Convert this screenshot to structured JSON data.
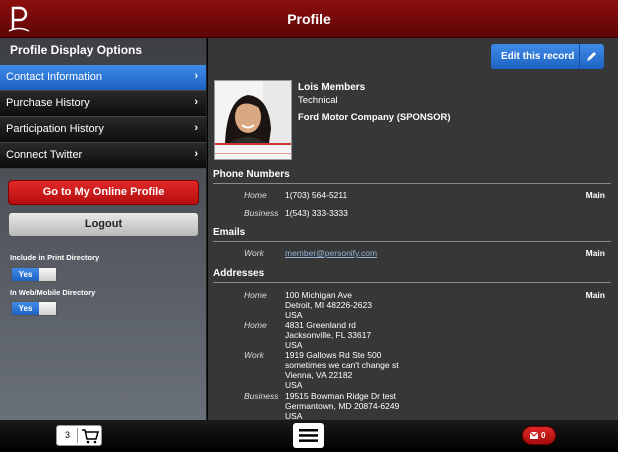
{
  "header": {
    "title": "Profile"
  },
  "sidebar": {
    "title": "Profile Display Options",
    "items": [
      {
        "label": "Contact Information",
        "active": true
      },
      {
        "label": "Purchase History",
        "active": false
      },
      {
        "label": "Participation History",
        "active": false
      },
      {
        "label": "Connect Twitter",
        "active": false
      }
    ],
    "online_profile_label": "Go to My Online Profile",
    "logout_label": "Logout",
    "print_directory": {
      "label": "Include in Print Directory",
      "value": "Yes"
    },
    "web_directory": {
      "label": "In Web/Mobile Directory",
      "value": "Yes"
    }
  },
  "main": {
    "edit_label": "Edit this record",
    "profile": {
      "name": "Lois Members",
      "job_title": "Technical",
      "company": "Ford Motor Company (SPONSOR)"
    },
    "phones": {
      "heading": "Phone Numbers",
      "rows": [
        {
          "type": "Home",
          "value": "1(703) 564-5211",
          "badge": "Main"
        },
        {
          "type": "Business",
          "value": "1(543) 333-3333",
          "badge": ""
        }
      ]
    },
    "emails": {
      "heading": "Emails",
      "rows": [
        {
          "type": "Work",
          "value": "member@personify.com",
          "badge": "Main"
        }
      ]
    },
    "addresses": {
      "heading": "Addresses",
      "rows": [
        {
          "type": "Home",
          "lines": [
            "100 Michigan Ave",
            "Detroit, MI 48226-2623",
            "USA"
          ],
          "badge": "Main"
        },
        {
          "type": "Home",
          "lines": [
            "4831 Greenland rd",
            "Jacksonville, FL 33617",
            "USA"
          ],
          "badge": ""
        },
        {
          "type": "Work",
          "lines": [
            "1919 Gallows Rd Ste 500",
            "sometimes we can't change st",
            "Vienna, VA 22182",
            "USA"
          ],
          "badge": ""
        },
        {
          "type": "Business",
          "lines": [
            "19515 Bowman Ridge Dr test",
            "Germantown, MD 20874-6249",
            "USA"
          ],
          "badge": ""
        }
      ]
    }
  },
  "footer": {
    "cart_count": "3",
    "message_count": "0"
  },
  "colors": {
    "header": "#7a0a0a",
    "accent_blue": "#2a73d6",
    "danger_red": "#d01a1a",
    "content_bg": "#373737"
  }
}
